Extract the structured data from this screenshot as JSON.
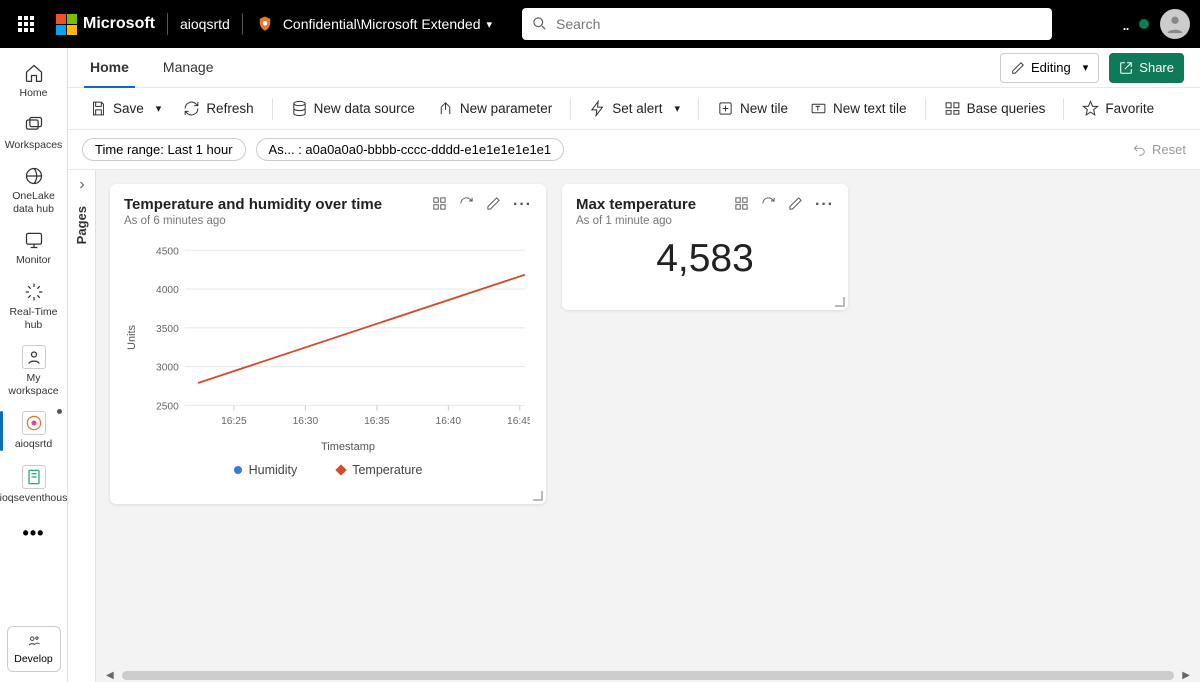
{
  "header": {
    "brand": "Microsoft",
    "context": "aioqsrtd",
    "confidential": "Confidential\\Microsoft Extended",
    "search_placeholder": "Search"
  },
  "leftnav": {
    "items": [
      {
        "label": "Home"
      },
      {
        "label": "Workspaces"
      },
      {
        "label": "OneLake data hub"
      },
      {
        "label": "Monitor"
      },
      {
        "label": "Real-Time hub"
      },
      {
        "label": "My workspace"
      },
      {
        "label": "aioqsrtd"
      },
      {
        "label": "aioqseventhouse"
      }
    ],
    "develop": "Develop"
  },
  "tabs": {
    "home": "Home",
    "manage": "Manage",
    "editing": "Editing",
    "share": "Share"
  },
  "toolbar": {
    "save": "Save",
    "refresh": "Refresh",
    "new_ds": "New data source",
    "new_param": "New parameter",
    "set_alert": "Set alert",
    "new_tile": "New tile",
    "new_text": "New text tile",
    "base_queries": "Base queries",
    "favorite": "Favorite"
  },
  "filters": {
    "time_range": "Time range: Last 1 hour",
    "asset": "As... : a0a0a0a0-bbbb-cccc-dddd-e1e1e1e1e1e1",
    "reset": "Reset"
  },
  "pages_label": "Pages",
  "tile1": {
    "title": "Temperature and humidity over time",
    "sub": "As of 6 minutes ago",
    "xlabel": "Timestamp",
    "ylabel": "Units",
    "legend_humidity": "Humidity",
    "legend_temperature": "Temperature"
  },
  "tile2": {
    "title": "Max temperature",
    "sub": "As of 1 minute ago",
    "value": "4,583"
  },
  "chart_data": {
    "type": "line",
    "title": "Temperature and humidity over time",
    "xlabel": "Timestamp",
    "ylabel": "Units",
    "ylim": [
      2500,
      4500
    ],
    "x_ticks": [
      "16:25",
      "16:30",
      "16:35",
      "16:40",
      "16:45"
    ],
    "y_ticks": [
      2500,
      3000,
      3500,
      4000,
      4500
    ],
    "series": [
      {
        "name": "Temperature",
        "color": "#d64b2b",
        "x": [
          "16:23",
          "16:47"
        ],
        "values": [
          2800,
          4200
        ]
      },
      {
        "name": "Humidity",
        "color": "#3a7bd5",
        "x": [],
        "values": []
      }
    ],
    "legend": [
      "Humidity",
      "Temperature"
    ]
  },
  "colors": {
    "accent": "#0f6cbd",
    "orange": "#d64b2b",
    "blue": "#3a7bd5",
    "share": "#0f7a5a"
  }
}
